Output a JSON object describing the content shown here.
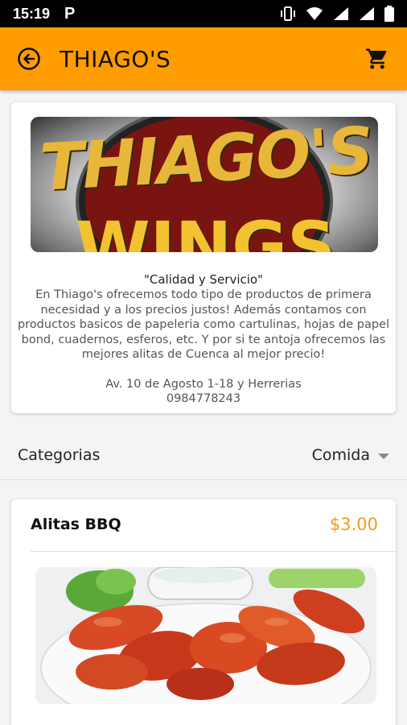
{
  "status_bar": {
    "time": "15:19",
    "app_indicator": "P",
    "icons": [
      "vibrate-icon",
      "wifi-icon",
      "signal-icon",
      "signal-icon-2",
      "battery-icon"
    ]
  },
  "app_bar": {
    "title": "THIAGO'S",
    "back_icon": "back-circle-arrow-icon",
    "cart_icon": "shopping-cart-icon",
    "color": "#ff9c00"
  },
  "store": {
    "banner_text_top": "THIAGO'S",
    "banner_text_bottom": "WINGS",
    "slogan": "\"Calidad y Servicio\"",
    "description": "En Thiago's ofrecemos todo tipo de productos de primera necesidad y a los precios justos! Además contamos con productos basicos de papeleria como cartulinas, hojas de papel bond, cuadernos, esferos, etc. Y por si te antoja ofrecemos las mejores alitas de Cuenca al mejor precio!",
    "address": "Av. 10 de Agosto 1-18 y Herrerias",
    "phone": "0984778243"
  },
  "category": {
    "label": "Categorias",
    "selected": "Comida"
  },
  "product": {
    "name": "Alitas BBQ",
    "price": "$3.00",
    "price_color": "#f39a1d"
  }
}
